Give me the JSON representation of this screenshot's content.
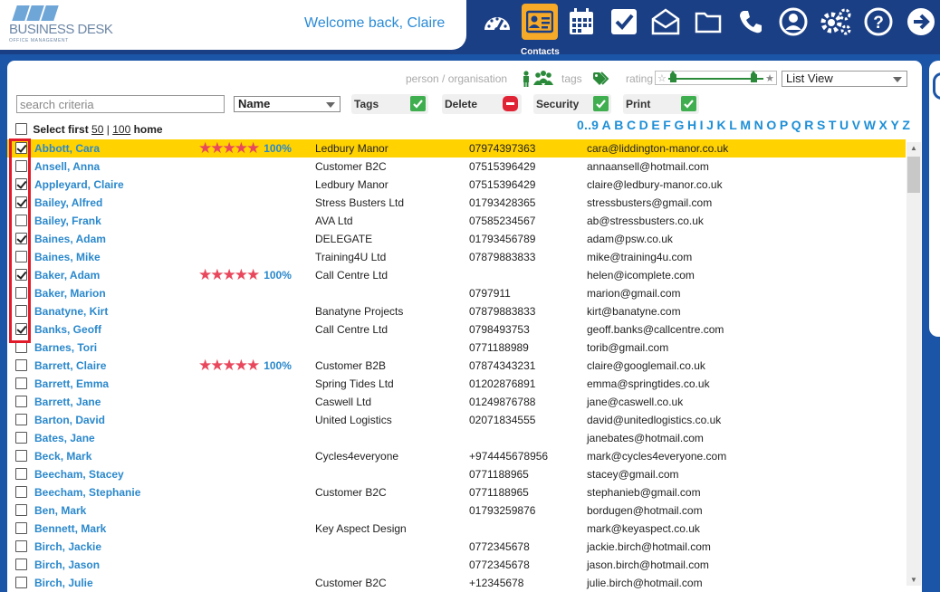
{
  "header": {
    "logo_text": "BUSINESS DESK",
    "logo_subtext": "OFFICE MANAGEMENT",
    "welcome": "Welcome back, Claire",
    "active_caption": "Contacts"
  },
  "toolbar": [
    "dashboard-icon",
    "contacts-icon",
    "calendar-icon",
    "tasks-icon",
    "mail-icon",
    "folder-icon",
    "phone-icon",
    "user-icon",
    "settings-icon",
    "help-icon",
    "logout-icon"
  ],
  "filters": {
    "person_org": "person / organisation",
    "tags": "tags",
    "rating": "rating",
    "view": "List View"
  },
  "search": {
    "placeholder": "search criteria"
  },
  "sort": {
    "value": "Name"
  },
  "actions": {
    "tags": "Tags",
    "delete": "Delete",
    "security": "Security",
    "print": "Print"
  },
  "select_first": {
    "label": "Select first",
    "opt1": "50",
    "sep": "|",
    "opt2": "100",
    "home": "home"
  },
  "alphabet": [
    "0..9",
    "A",
    "B",
    "C",
    "D",
    "E",
    "F",
    "G",
    "H",
    "I",
    "J",
    "K",
    "L",
    "M",
    "N",
    "O",
    "P",
    "Q",
    "R",
    "S",
    "T",
    "U",
    "V",
    "W",
    "X",
    "Y",
    "Z"
  ],
  "colors": {
    "accent": "#1d8fd6",
    "highlight": "#ffd200",
    "header": "#1b3f84",
    "active_tab": "#f7a928",
    "star": "#e8475c",
    "red_box": "#e21b2a"
  },
  "contacts": [
    {
      "name": "Abbott, Cara",
      "stars": "★★★★★",
      "pct": "100%",
      "org": "Ledbury Manor",
      "phone": "07974397363",
      "email": "cara@liddington-manor.co.uk",
      "checked": true,
      "highlight": true
    },
    {
      "name": "Ansell, Anna",
      "stars": "",
      "pct": "",
      "org": "Customer B2C",
      "phone": "07515396429",
      "email": "annaansell@hotmail.com",
      "checked": false
    },
    {
      "name": "Appleyard, Claire",
      "stars": "",
      "pct": "",
      "org": "Ledbury Manor",
      "phone": "07515396429",
      "email": "claire@ledbury-manor.co.uk",
      "checked": true
    },
    {
      "name": "Bailey, Alfred",
      "stars": "",
      "pct": "",
      "org": "Stress Busters Ltd",
      "phone": "01793428365",
      "email": "stressbusters@gmail.com",
      "checked": true
    },
    {
      "name": "Bailey, Frank",
      "stars": "",
      "pct": "",
      "org": "AVA Ltd",
      "phone": "07585234567",
      "email": "ab@stressbusters.co.uk",
      "checked": false
    },
    {
      "name": "Baines, Adam",
      "stars": "",
      "pct": "",
      "org": "DELEGATE",
      "phone": "01793456789",
      "email": "adam@psw.co.uk",
      "checked": true
    },
    {
      "name": "Baines, Mike",
      "stars": "",
      "pct": "",
      "org": "Training4U Ltd",
      "phone": "07879883833",
      "email": "mike@training4u.com",
      "checked": false
    },
    {
      "name": "Baker, Adam",
      "stars": "★★★★★",
      "pct": "100%",
      "org": "Call Centre Ltd",
      "phone": "",
      "email": "helen@icomplete.com",
      "checked": true
    },
    {
      "name": "Baker, Marion",
      "stars": "",
      "pct": "",
      "org": "",
      "phone": "0797911",
      "email": "marion@gmail.com",
      "checked": false
    },
    {
      "name": "Banatyne, Kirt",
      "stars": "",
      "pct": "",
      "org": "Banatyne Projects",
      "phone": "07879883833",
      "email": "kirt@banatyne.com",
      "checked": false
    },
    {
      "name": "Banks, Geoff",
      "stars": "",
      "pct": "",
      "org": "Call Centre Ltd",
      "phone": "0798493753",
      "email": "geoff.banks@callcentre.com",
      "checked": true
    },
    {
      "name": "Barnes, Tori",
      "stars": "",
      "pct": "",
      "org": "",
      "phone": "0771188989",
      "email": "torib@gmail.com",
      "checked": false
    },
    {
      "name": "Barrett, Claire",
      "stars": "★★★★★",
      "pct": "100%",
      "org": "Customer B2B",
      "phone": "07874343231",
      "email": "claire@googlemail.co.uk",
      "checked": false
    },
    {
      "name": "Barrett, Emma",
      "stars": "",
      "pct": "",
      "org": "Spring Tides Ltd",
      "phone": "01202876891",
      "email": "emma@springtides.co.uk",
      "checked": false
    },
    {
      "name": "Barrett, Jane",
      "stars": "",
      "pct": "",
      "org": "Caswell Ltd",
      "phone": "01249876788",
      "email": "jane@caswell.co.uk",
      "checked": false
    },
    {
      "name": "Barton, David",
      "stars": "",
      "pct": "",
      "org": "United Logistics",
      "phone": "02071834555",
      "email": "david@unitedlogistics.co.uk",
      "checked": false
    },
    {
      "name": "Bates, Jane",
      "stars": "",
      "pct": "",
      "org": "",
      "phone": "",
      "email": "janebates@hotmail.com",
      "checked": false
    },
    {
      "name": "Beck, Mark",
      "stars": "",
      "pct": "",
      "org": "Cycles4everyone",
      "phone": "+974445678956",
      "email": "mark@cycles4everyone.com",
      "checked": false
    },
    {
      "name": "Beecham, Stacey",
      "stars": "",
      "pct": "",
      "org": "",
      "phone": "0771188965",
      "email": "stacey@gmail.com",
      "checked": false
    },
    {
      "name": "Beecham, Stephanie",
      "stars": "",
      "pct": "",
      "org": "Customer B2C",
      "phone": "0771188965",
      "email": "stephanieb@gmail.com",
      "checked": false
    },
    {
      "name": "Ben, Mark",
      "stars": "",
      "pct": "",
      "org": "",
      "phone": "01793259876",
      "email": "bordugen@hotmail.com",
      "checked": false
    },
    {
      "name": "Bennett, Mark",
      "stars": "",
      "pct": "",
      "org": "Key Aspect Design",
      "phone": "",
      "email": "mark@keyaspect.co.uk",
      "checked": false
    },
    {
      "name": "Birch, Jackie",
      "stars": "",
      "pct": "",
      "org": "",
      "phone": "0772345678",
      "email": "jackie.birch@hotmail.com",
      "checked": false
    },
    {
      "name": "Birch, Jason",
      "stars": "",
      "pct": "",
      "org": "",
      "phone": "0772345678",
      "email": "jason.birch@hotmail.com",
      "checked": false
    },
    {
      "name": "Birch, Julie",
      "stars": "",
      "pct": "",
      "org": "Customer B2C",
      "phone": "+12345678",
      "email": "julie.birch@hotmail.com",
      "checked": false
    }
  ]
}
